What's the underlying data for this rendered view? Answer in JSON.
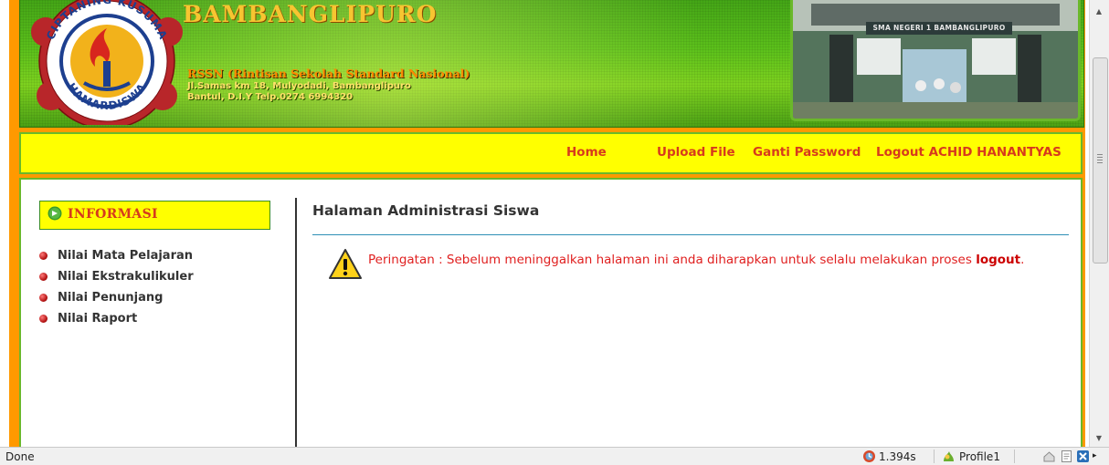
{
  "header": {
    "school_name": "BAMBANGLIPURO",
    "program": "RSSN (Rintisan Sekolah Standard Nasional)",
    "address_line1": "Jl.Samas km 18, Mulyodadi, Bambanglipuro",
    "address_line2": "Bantul, D.I.Y Telp.0274 6994320",
    "logo_ring_text": "CIPTANING KUSUMA",
    "logo_lower_text": "HAMARDISWA",
    "photo_sign": "SMA NEGERI 1 BAMBANGLIPURO"
  },
  "nav": {
    "home": "Home",
    "upload": "Upload File",
    "password": "Ganti Password",
    "logout": "Logout ACHID HANANTYAS"
  },
  "sidebar": {
    "title": "INFORMASI",
    "items": [
      {
        "label": "Nilai Mata Pelajaran"
      },
      {
        "label": "Nilai Ekstrakulikuler"
      },
      {
        "label": "Nilai Penunjang"
      },
      {
        "label": "Nilai Raport"
      }
    ]
  },
  "main": {
    "title": "Halaman Administrasi Siswa",
    "warning_text": "Peringatan : Sebelum meninggalkan halaman ini anda diharapkan untuk selalu melakukan proses ",
    "warning_link": "logout",
    "warning_end": "."
  },
  "status": {
    "text": "Done",
    "timing": "1.394s",
    "profile": "Profile1"
  },
  "colors": {
    "frame": "#ff9900",
    "nav_bg": "#ffff00",
    "nav_link": "#d63a1d",
    "border_green": "#6ab82a",
    "warning": "#e02020"
  }
}
